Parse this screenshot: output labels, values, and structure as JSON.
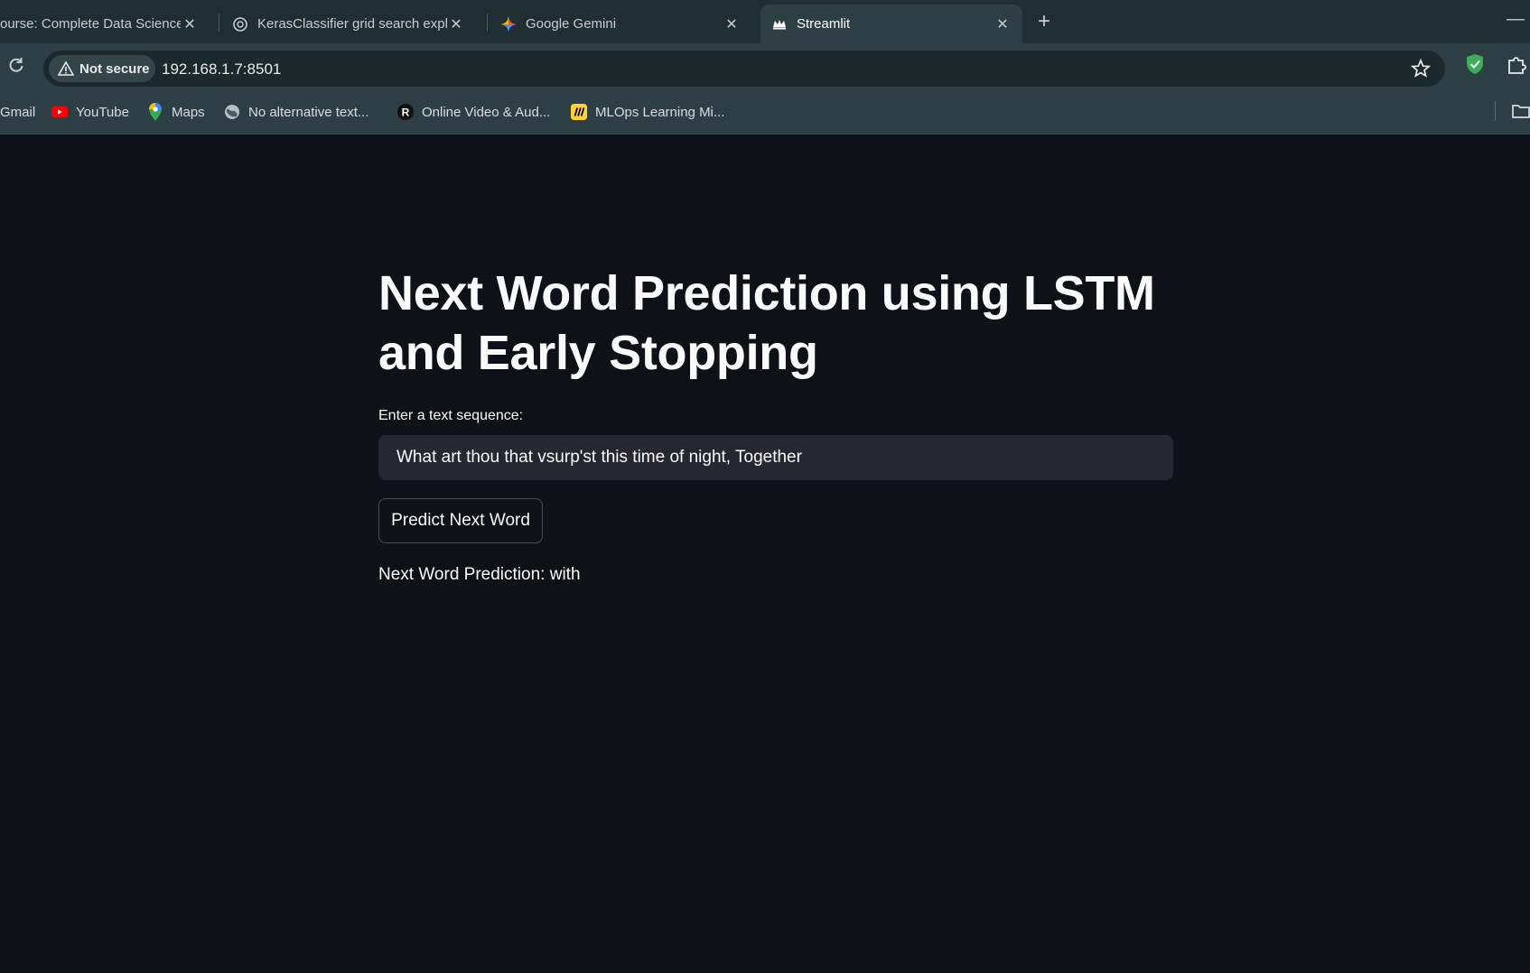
{
  "browser": {
    "tabs": [
      {
        "title": "ourse: Complete Data Science",
        "favicon": "none"
      },
      {
        "title": "KerasClassifier grid search expla",
        "favicon": "openai-icon"
      },
      {
        "title": "Google Gemini",
        "favicon": "gemini-icon"
      },
      {
        "title": "Streamlit",
        "favicon": "streamlit-icon",
        "active": true
      }
    ],
    "security_label": "Not secure",
    "url": "192.168.1.7:8501",
    "bookmarks": [
      {
        "label": "Gmail",
        "icon": "none"
      },
      {
        "label": "YouTube",
        "icon": "youtube-icon"
      },
      {
        "label": "Maps",
        "icon": "maps-icon"
      },
      {
        "label": "No alternative text...",
        "icon": "globe-icon"
      },
      {
        "label": "Online Video & Aud...",
        "icon": "r-logo-icon"
      },
      {
        "label": "MLOps Learning Mi...",
        "icon": "miro-icon"
      }
    ]
  },
  "app": {
    "title": "Next Word Prediction using LSTM and Early Stopping",
    "input_label": "Enter a text sequence:",
    "input_value": "What art thou that vsurp'st this time of night, Together",
    "button_label": "Predict Next Word",
    "prediction_text": "Next Word Prediction: with"
  },
  "colors": {
    "app_background": "#0e1117",
    "input_background": "#262730",
    "chrome_tabstrip": "#1f2e33",
    "chrome_toolbar": "#2d3f44"
  }
}
